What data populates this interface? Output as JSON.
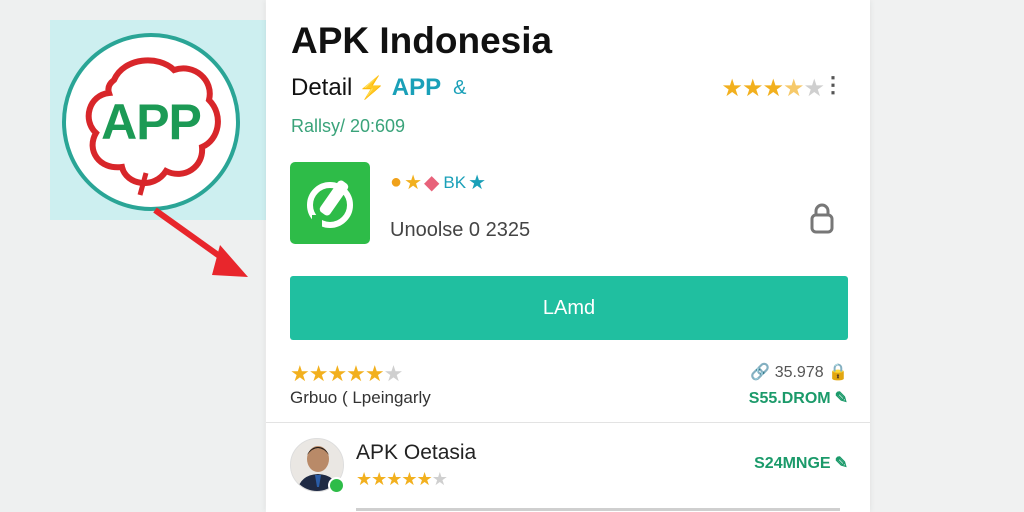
{
  "logo": {
    "text": "APP",
    "icon": "app-logo-blob"
  },
  "card": {
    "title": "APK Indonesia",
    "detail_label": "Detail",
    "app_tag": "APP",
    "amp": "&",
    "top_rating_stars": "★★★★★",
    "kebab": "⋮",
    "rating_text": "Rallsy/ 20:609",
    "meta_bk": "BK",
    "update_text": "Unoolse 0 2325",
    "install_label": "LAmd",
    "stars": {
      "filled": 4,
      "total": 5
    },
    "category": "Grbuo ( Lpeingarly",
    "stat": "35.978",
    "price": "S55.DROM",
    "developer": {
      "name": "APK Oetasia",
      "price": "S24MNGE",
      "stars": {
        "filled": 4,
        "total": 5
      }
    }
  },
  "colors": {
    "accent": "#20bfa0",
    "green": "#2ebc48",
    "star": "#f2b01e"
  }
}
